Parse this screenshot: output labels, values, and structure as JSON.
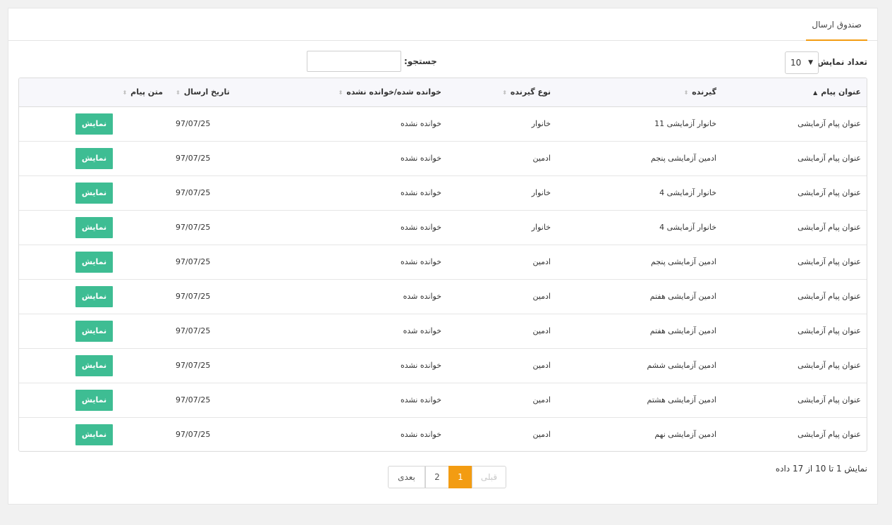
{
  "header": {
    "tab_title": "صندوق ارسال"
  },
  "controls": {
    "length_label": "تعداد نمایش",
    "length_value": "10",
    "search_label": "جستجو:",
    "search_value": ""
  },
  "table": {
    "columns": [
      "عنوان پیام",
      "گیرنده",
      "نوع گیرنده",
      "خوانده شده/خوانده نشده",
      "تاریخ ارسال",
      "متن پیام"
    ],
    "rows": [
      {
        "title": "عنوان پیام آزمایشی",
        "recipient": "خانوار آزمایشی 11",
        "type": "خانوار",
        "status": "خوانده نشده",
        "date": "97/07/25",
        "action": "نمایش"
      },
      {
        "title": "عنوان پیام آزمایشی",
        "recipient": "ادمین آزمایشی پنجم",
        "type": "ادمین",
        "status": "خوانده نشده",
        "date": "97/07/25",
        "action": "نمایش"
      },
      {
        "title": "عنوان پیام آزمایشی",
        "recipient": "خانوار آزمایشی 4",
        "type": "خانوار",
        "status": "خوانده نشده",
        "date": "97/07/25",
        "action": "نمایش"
      },
      {
        "title": "عنوان پیام آزمایشی",
        "recipient": "خانوار آزمایشی 4",
        "type": "خانوار",
        "status": "خوانده نشده",
        "date": "97/07/25",
        "action": "نمایش"
      },
      {
        "title": "عنوان پیام آزمایشی",
        "recipient": "ادمین آزمایشی پنجم",
        "type": "ادمین",
        "status": "خوانده نشده",
        "date": "97/07/25",
        "action": "نمایش"
      },
      {
        "title": "عنوان پیام آزمایشی",
        "recipient": "ادمین آزمایشی هفتم",
        "type": "ادمین",
        "status": "خوانده شده",
        "date": "97/07/25",
        "action": "نمایش"
      },
      {
        "title": "عنوان پیام آزمایشی",
        "recipient": "ادمین آزمایشی هفتم",
        "type": "ادمین",
        "status": "خوانده شده",
        "date": "97/07/25",
        "action": "نمایش"
      },
      {
        "title": "عنوان پیام آزمایشی",
        "recipient": "ادمین آزمایشی ششم",
        "type": "ادمین",
        "status": "خوانده نشده",
        "date": "97/07/25",
        "action": "نمایش"
      },
      {
        "title": "عنوان پیام آزمایشی",
        "recipient": "ادمین آزمایشی هشتم",
        "type": "ادمین",
        "status": "خوانده نشده",
        "date": "97/07/25",
        "action": "نمایش"
      },
      {
        "title": "عنوان پیام آزمایشی",
        "recipient": "ادمین آزمایشی نهم",
        "type": "ادمین",
        "status": "خوانده نشده",
        "date": "97/07/25",
        "action": "نمایش"
      }
    ]
  },
  "footer": {
    "info": "نمایش 1 تا 10 از 17 داده",
    "pagination": {
      "prev": "قبلی",
      "pages": [
        "1",
        "2"
      ],
      "active": "1",
      "next": "بعدی"
    }
  },
  "colors": {
    "accent": "#f39c12",
    "button": "#3ebd93"
  },
  "icons": {
    "sort_active": "triangle-up-icon",
    "sort_idle": "sort-both-icon",
    "select_arrow": "triangle-down-icon"
  }
}
